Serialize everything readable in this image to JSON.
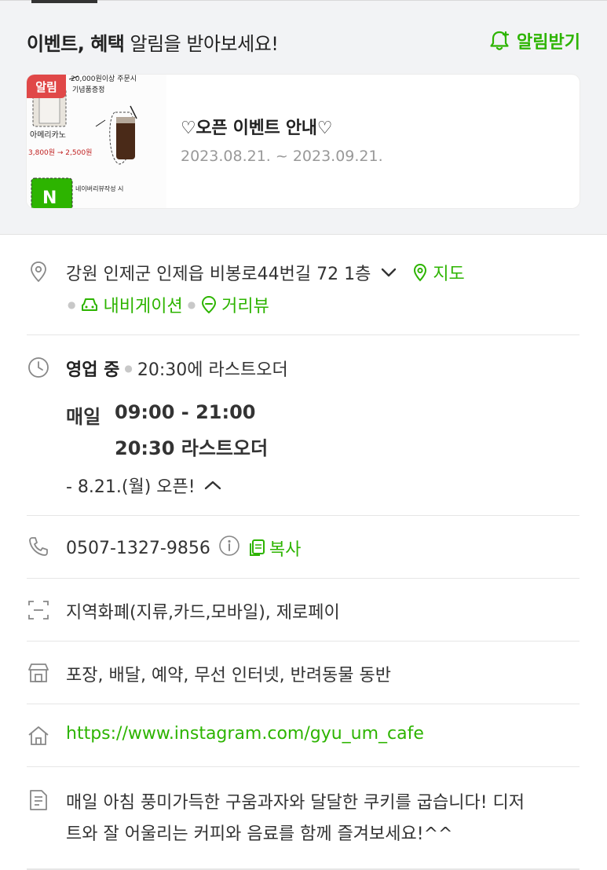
{
  "event": {
    "header_bold": "이벤트, 혜택",
    "header_rest": "알림을 받아보세요!",
    "alert_label": "알림받기",
    "card": {
      "badge": "알림",
      "title": "♡오픈 이벤트 안내♡",
      "date": "2023.08.21. ~ 2023.09.21.",
      "thumb_notes": [
        "20,000원이상 주문시",
        "기념품증정",
        "아메리카노",
        "3,800원 → 2,500원",
        "네이버리뷰작성 시"
      ]
    }
  },
  "address": {
    "text": "강원 인제군 인제읍 비봉로44번길 72 1층",
    "map_label": "지도",
    "navi_label": "내비게이션",
    "street_label": "거리뷰"
  },
  "hours": {
    "status": "영업 중",
    "last_order": "20:30에 라스트오더",
    "day": "매일",
    "time": "09:00 - 21:00",
    "lo_line": "20:30 라스트오더",
    "note": "- 8.21.(월) 오픈!"
  },
  "phone": {
    "number": "0507-1327-9856",
    "copy_label": "복사"
  },
  "payment": {
    "text": "지역화폐(지류,카드,모바일), 제로페이"
  },
  "amenities": {
    "text": "포장, 배달, 예약, 무선 인터넷, 반려동물 동반"
  },
  "website": {
    "url": "https://www.instagram.com/gyu_um_cafe"
  },
  "description": {
    "line1": "매일 아침 풍미가득한 구움과자와 달달한 쿠키를 굽습니다! 디저",
    "line2": "트와 잘 어울리는 커피와 음료를 함께 즐겨보세요!^^"
  },
  "colors": {
    "accent": "#2db400",
    "badge": "#e04848",
    "bg_gray": "#f2f3f5"
  }
}
